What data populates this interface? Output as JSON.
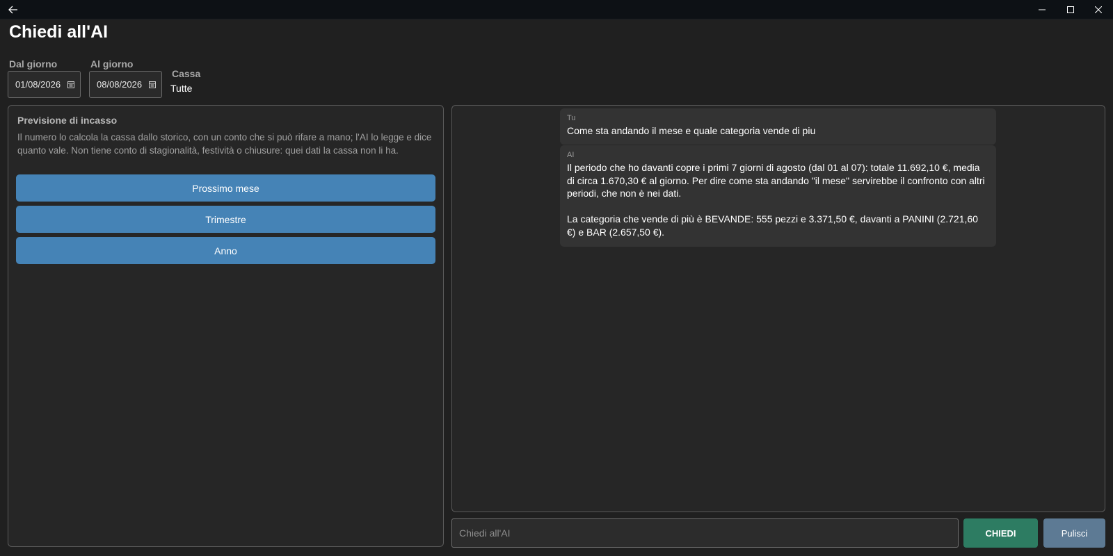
{
  "window": {
    "back_icon": "arrow-left-icon",
    "minimize_icon": "minimize-icon",
    "maximize_icon": "maximize-icon",
    "close_icon": "close-icon"
  },
  "page": {
    "title": "Chiedi all'AI"
  },
  "filters": {
    "from_label": "Dal giorno",
    "from_value": "01/08/2026",
    "to_label": "Al giorno",
    "to_value": "08/08/2026",
    "register_label": "Cassa",
    "register_value": "Tutte",
    "calendar_icon": "calendar-icon"
  },
  "forecast": {
    "heading": "Previsione di incasso",
    "description": "Il numero lo calcola la cassa dallo storico, con un conto che si può rifare a mano; l'AI lo legge e dice quanto vale. Non tiene conto di stagionalità, festività o chiusure: quei dati la cassa non li ha.",
    "buttons": [
      "Prossimo mese",
      "Trimestre",
      "Anno"
    ]
  },
  "chat": {
    "messages": [
      {
        "sender": "Tu",
        "text": "Come sta andando il mese e quale categoria vende di piu"
      },
      {
        "sender": "AI",
        "text": "Il periodo che ho davanti copre i primi 7 giorni di agosto (dal 01 al 07): totale 11.692,10 €, media di circa 1.670,30 € al giorno. Per dire come sta andando \"il mese\" servirebbe il confronto con altri periodi, che non è nei dati.\n\nLa categoria che vende di più è BEVANDE: 555 pezzi e 3.371,50 €, davanti a PANINI (2.721,60 €) e BAR (2.657,50 €)."
      }
    ],
    "input_placeholder": "Chiedi all'AI",
    "input_value": "",
    "ask_label": "CHIEDI",
    "clear_label": "Pulisci"
  },
  "colors": {
    "background": "#202020",
    "forecast_button": "#4583b6",
    "ask_button": "#2d7c62",
    "clear_button": "#5d7a94"
  }
}
